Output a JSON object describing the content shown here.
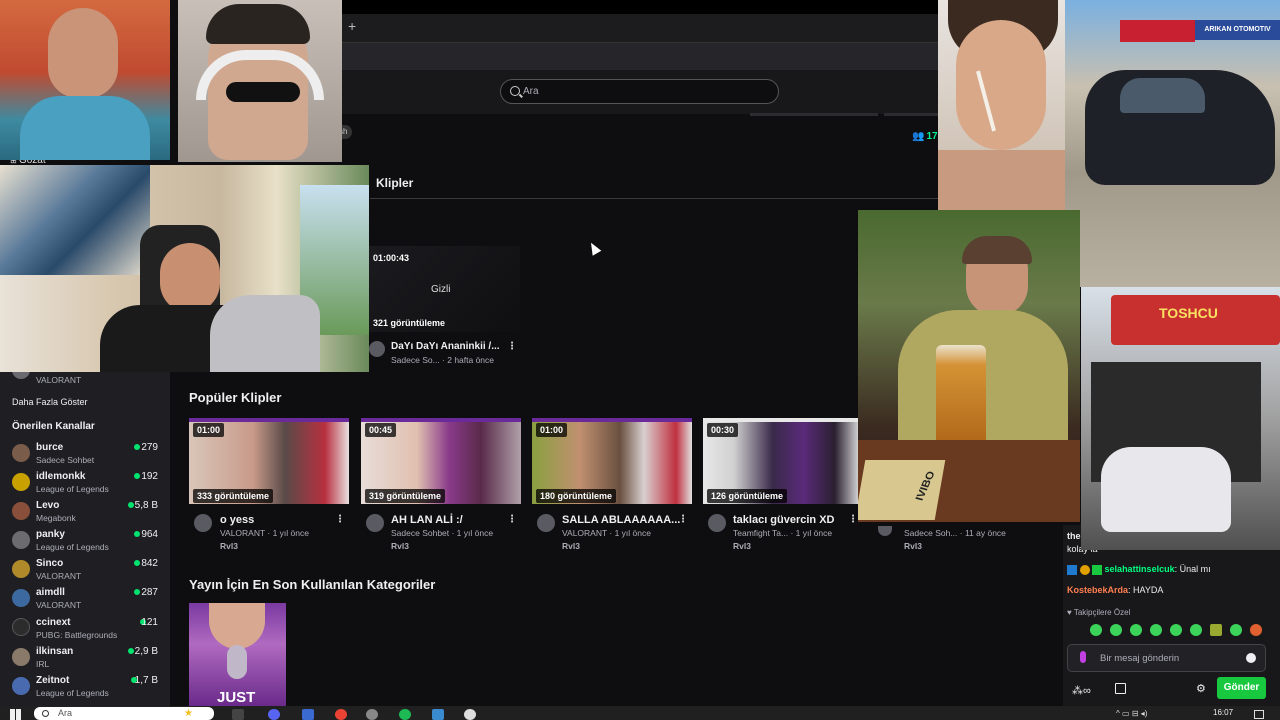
{
  "browser": {
    "new_tab_icon": "plus-icon"
  },
  "search": {
    "placeholder": "Ara",
    "icon": "search-icon"
  },
  "header": {
    "viewer_count": "17",
    "viewer_icon": "viewers-icon",
    "browse_label": "Gözat",
    "tag_label": "sh"
  },
  "clips_section": {
    "tab_label": "Klipler",
    "featured_clip": {
      "duration": "01:00:43",
      "views": "321 görüntüleme",
      "overlay_label": "Gizli",
      "title": "DaYı DaYı Ananinkii /...",
      "meta": "Sadece So... · 2 hafta önce"
    }
  },
  "popular_clips": {
    "title": "Popüler Klipler",
    "items": [
      {
        "duration": "01:00",
        "views": "333 görüntüleme",
        "title": "o yess",
        "meta": "VALORANT · 1 yıl önce",
        "author": "Rvl3"
      },
      {
        "duration": "00:45",
        "views": "319 görüntüleme",
        "title": "AH LAN ALİ :/",
        "meta": "Sadece Sohbet · 1 yıl önce",
        "author": "Rvl3"
      },
      {
        "duration": "01:00",
        "views": "180 görüntüleme",
        "title": "SALLA ABLAAAAAA...",
        "meta": "VALORANT · 1 yıl önce",
        "author": "Rvl3"
      },
      {
        "duration": "00:30",
        "views": "126 görüntüleme",
        "title": "taklacı güvercin XD",
        "meta": "Teamfight Ta... · 1 yıl önce",
        "author": "Rvl3"
      },
      {
        "meta": "Sadece Soh... · 11 ay önce",
        "author": "Rvl3"
      }
    ]
  },
  "categories_section": {
    "title": "Yayın İçin En Son Kullanılan Kategoriler",
    "card_text": "JUST"
  },
  "sidebar": {
    "top_category": "VALORANT",
    "show_more": "Daha Fazla Göster",
    "recommended_title": "Önerilen Kanallar",
    "channels": [
      {
        "name": "burce",
        "category": "Sadece Sohbet",
        "viewers": "279",
        "color": "#7a5c4a"
      },
      {
        "name": "idlemonkk",
        "category": "League of Legends",
        "viewers": "192",
        "color": "#c8a000"
      },
      {
        "name": "Levo",
        "category": "Megabonk",
        "viewers": "5,8 B",
        "color": "#8a4f3a"
      },
      {
        "name": "panky",
        "category": "League of Legends",
        "viewers": "964",
        "color": "#6b6b70"
      },
      {
        "name": "Sinco",
        "category": "VALORANT",
        "viewers": "842",
        "color": "#b08a2a"
      },
      {
        "name": "aimdll",
        "category": "VALORANT",
        "viewers": "287",
        "color": "#3c6aa0"
      },
      {
        "name": "ccinext",
        "category": "PUBG: Battlegrounds",
        "viewers": "121",
        "color": "#2c2c2c"
      },
      {
        "name": "ilkinsan",
        "category": "IRL",
        "viewers": "2,9 B",
        "color": "#8a7a6a"
      },
      {
        "name": "Zeitnot",
        "category": "League of Legends",
        "viewers": "1,7 B",
        "color": "#4a6ab0"
      }
    ]
  },
  "chat": {
    "partial_line_1": "the",
    "partial_line_2": "kolay la",
    "messages": [
      {
        "user": "selahattinselcuk",
        "text": ": Ünal mı",
        "user_color": "#00ff7f"
      },
      {
        "user": "KostebekArda",
        "text": ": HAYDA",
        "user_color": "#ff7f50"
      }
    ],
    "followers_only_label": "Takipçilere Özel",
    "input_placeholder": "Bir mesaj gönderin",
    "send_label": "Gönder",
    "mic_icon": "mic-icon",
    "emote_icon": "smiley-icon",
    "settings_icon": "gear-icon"
  },
  "taskbar": {
    "search_placeholder": "Ara",
    "clock": "16:07"
  },
  "overlay_photos": {
    "cam4_text": "IVIBO",
    "shop_sign": "TOSHCU",
    "sign1": "ARIKAN OTOMOTIV"
  }
}
